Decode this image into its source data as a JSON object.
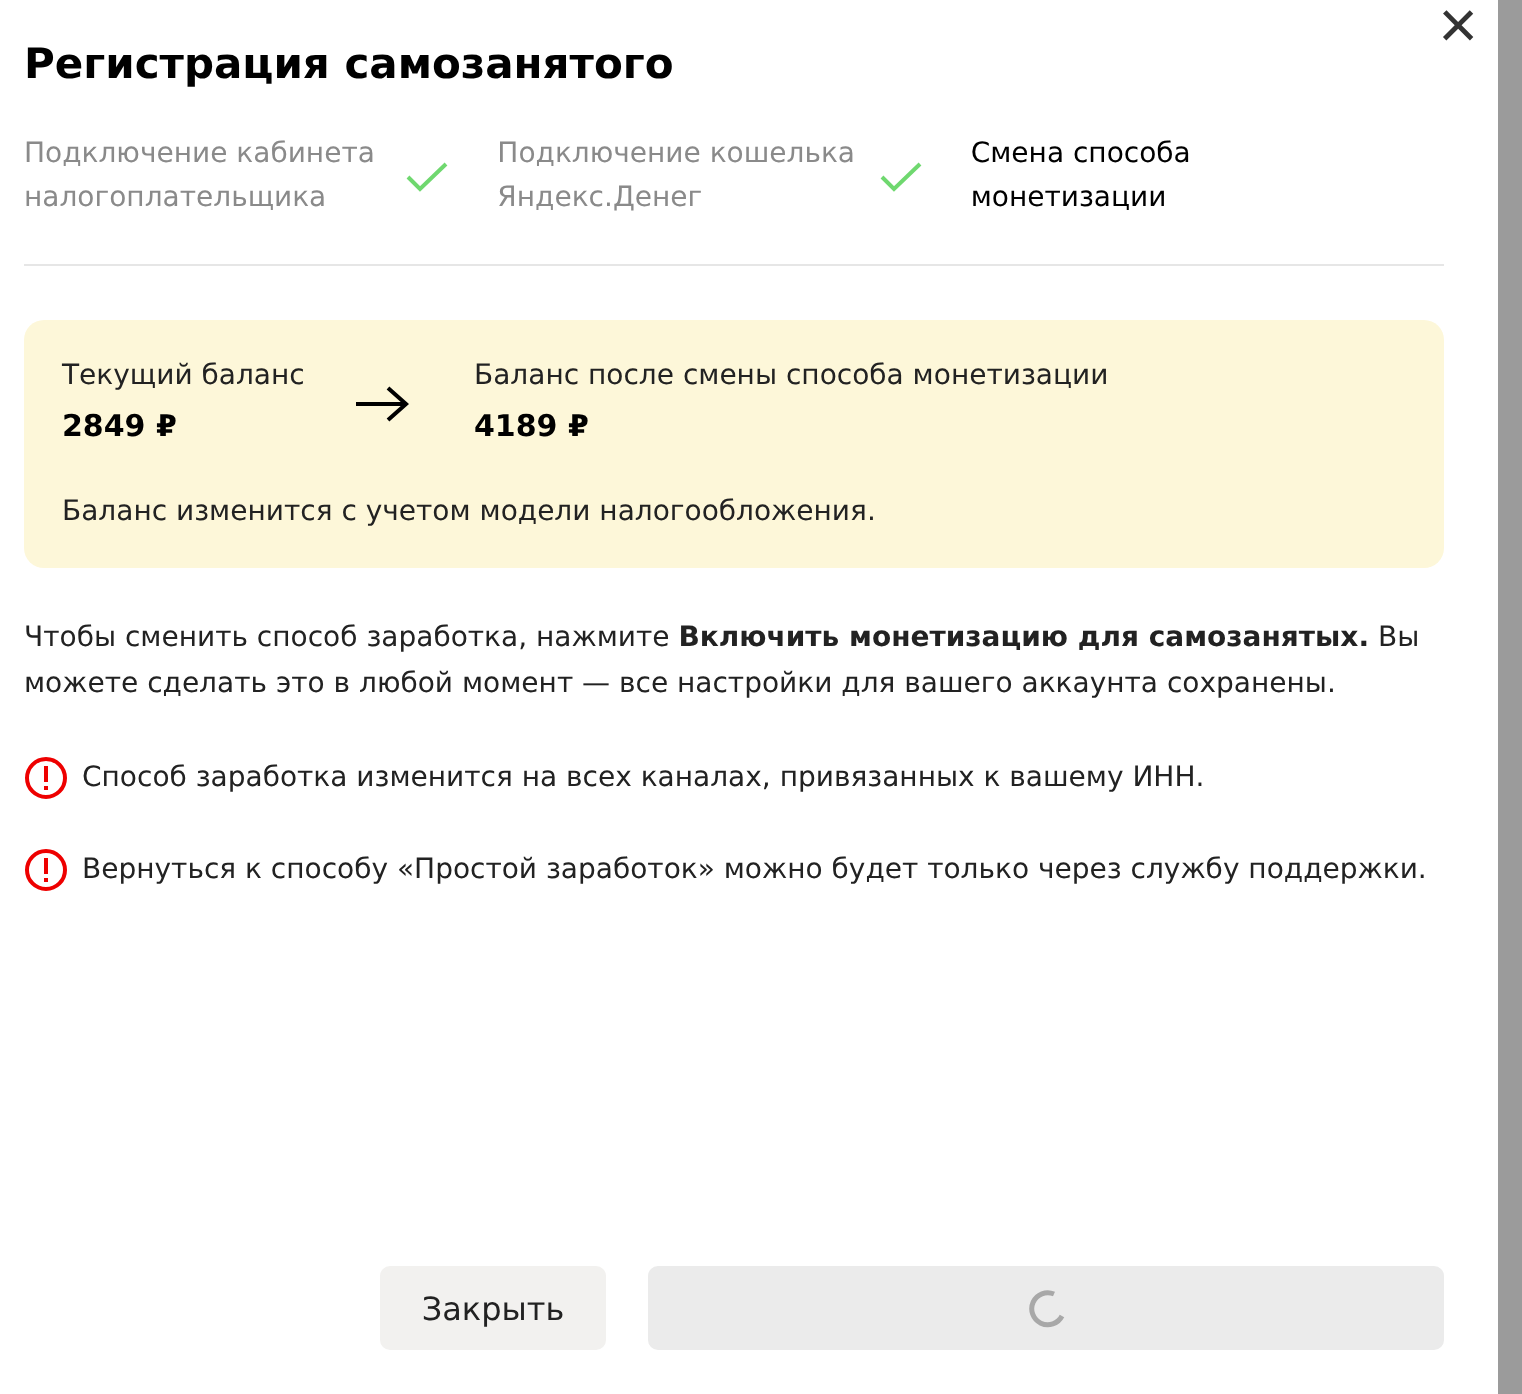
{
  "dialog": {
    "title": "Регистрация самозанятого",
    "close_icon": "×"
  },
  "steps": [
    {
      "label": "Подключение кабинета налогоплательщика",
      "done": true
    },
    {
      "label": "Подключение кошелька Яндекс.Денег",
      "done": true
    },
    {
      "label": "Смена способа монетизации",
      "done": false
    }
  ],
  "balance_card": {
    "current_label": "Текущий баланс",
    "current_value": "2849 ₽",
    "new_label": "Баланс после смены способа монетизации",
    "new_value": "4189 ₽",
    "note": "Баланс изменится с учетом модели налогообложения."
  },
  "description": "Чтобы сменить способ заработка, нажмите **Включить монетизацию для самозанятых.** Вы можете сделать это в любой момент — все настройки для вашего аккаунта сохранены.",
  "warnings": [
    "Способ заработка изменится на всех каналах, привязанных к вашему ИНН.",
    "Вернуться к способу «Простой заработок» можно будет только через службу поддержки."
  ],
  "buttons": {
    "close": "Закрыть",
    "confirm_loading": true
  }
}
